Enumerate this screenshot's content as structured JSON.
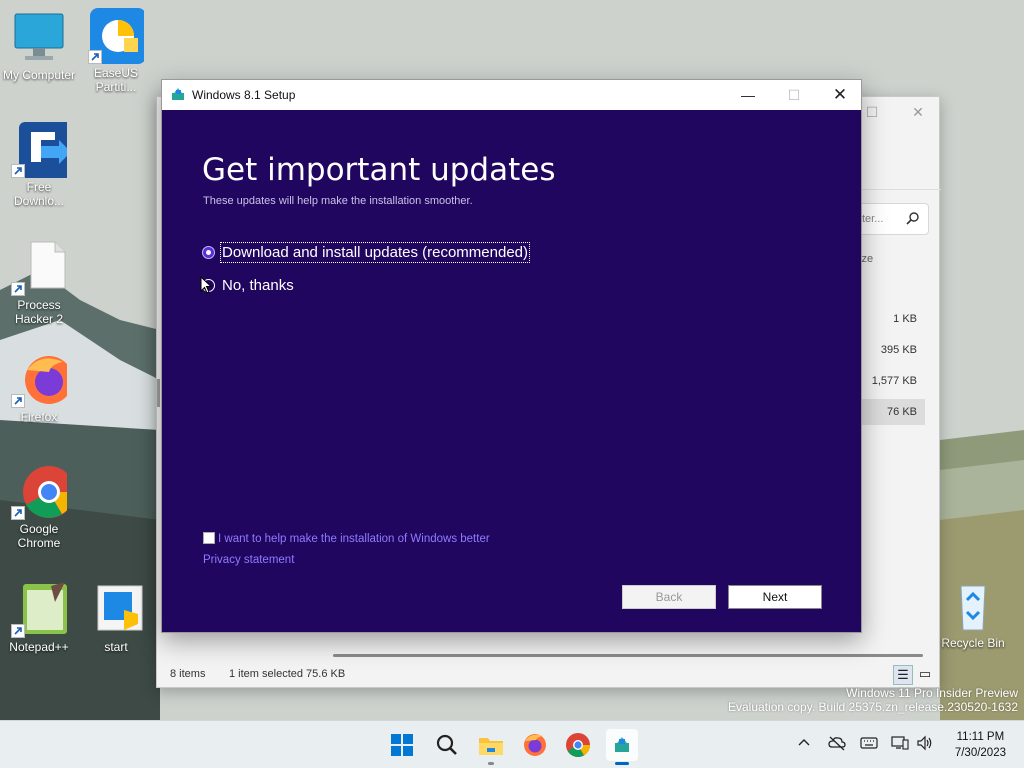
{
  "desktop": {
    "icons": [
      {
        "label": "My Computer"
      },
      {
        "label": "EaseUS Partiti..."
      },
      {
        "label": "Free Downlo..."
      },
      {
        "label": "Process Hacker 2"
      },
      {
        "label": "Firefox"
      },
      {
        "label": "Google Chrome"
      },
      {
        "label": "Notepad++"
      },
      {
        "label": "start"
      },
      {
        "label": "Recycle Bin"
      }
    ]
  },
  "explorer": {
    "search_placeholder": "ter...",
    "size_header": "ize",
    "sizes": [
      "1 KB",
      "395 KB",
      "1,577 KB",
      "76 KB"
    ],
    "status_items": "8 items",
    "status_selected": "1 item selected  75.6 KB"
  },
  "setup": {
    "window_title": "Windows 8.1 Setup",
    "heading": "Get important updates",
    "subheading": "These updates will help make the installation smoother.",
    "option_download": "Download and install updates (recommended)",
    "option_no": "No, thanks",
    "help_checkbox_label": "I want to help make the installation of Windows better",
    "privacy_link": "Privacy statement",
    "back_label": "Back",
    "next_label": "Next"
  },
  "watermark": {
    "line1": "Windows 11 Pro Insider Preview",
    "line2": "Evaluation copy. Build 25375.zn_release.230520-1632"
  },
  "taskbar": {
    "time": "11:11 PM",
    "date": "7/30/2023"
  },
  "colors": {
    "setup_bg": "#210660",
    "link": "#8e7bff",
    "accent": "#0067c0"
  }
}
